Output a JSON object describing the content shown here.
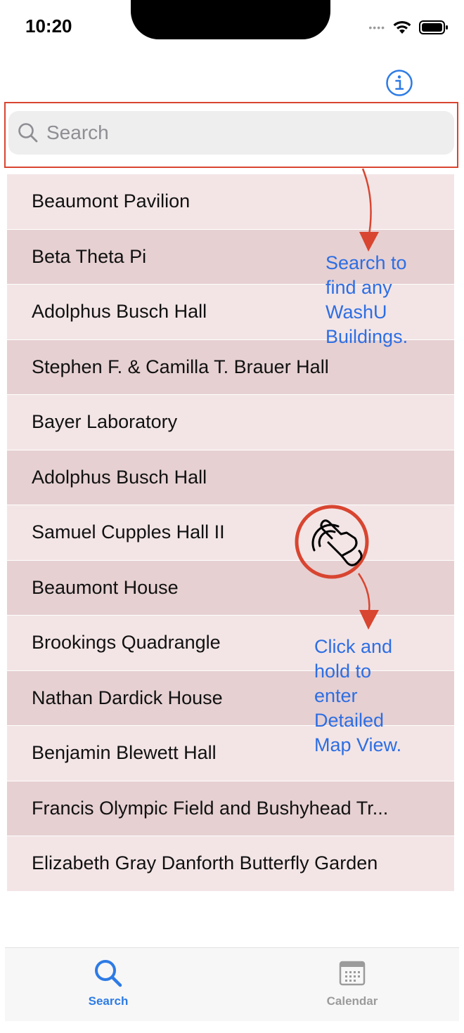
{
  "status_bar": {
    "time": "10:20",
    "signal_icon": "signal-dots-icon",
    "wifi_icon": "wifi-icon",
    "battery_icon": "battery-icon"
  },
  "header": {
    "info_icon": "info-circle-icon"
  },
  "search": {
    "placeholder": "Search",
    "value": "",
    "icon": "magnifier-icon"
  },
  "buildings": [
    "Beaumont Pavilion",
    "Beta Theta Pi",
    "Adolphus Busch Hall",
    "Stephen F. & Camilla T. Brauer Hall",
    "Bayer Laboratory",
    "Adolphus Busch Hall",
    "Samuel Cupples Hall II",
    "Beaumont House",
    "Brookings Quadrangle",
    "Nathan Dardick House",
    "Benjamin Blewett Hall",
    "Francis Olympic Field and Bushyhead Tr...",
    "Elizabeth Gray Danforth Butterfly Garden"
  ],
  "annotations": {
    "search_hint": [
      "Search to",
      "find any",
      "WashU",
      "Buildings."
    ],
    "hold_hint": [
      "Click and",
      "hold to",
      "enter",
      "Detailed",
      "Map View."
    ],
    "tap_icon": "tap-hand-icon"
  },
  "tab_bar": {
    "tabs": [
      {
        "label": "Search",
        "icon": "search-icon",
        "selected": true
      },
      {
        "label": "Calendar",
        "icon": "calendar-icon",
        "selected": false
      }
    ]
  },
  "colors": {
    "accent": "#2d7be5",
    "annotation_red": "#d84530",
    "annotation_blue": "#2d6ee3",
    "row_light": "#f3e5e6",
    "row_dark": "#e6d0d2",
    "tab_inactive": "#9b9b9b"
  }
}
